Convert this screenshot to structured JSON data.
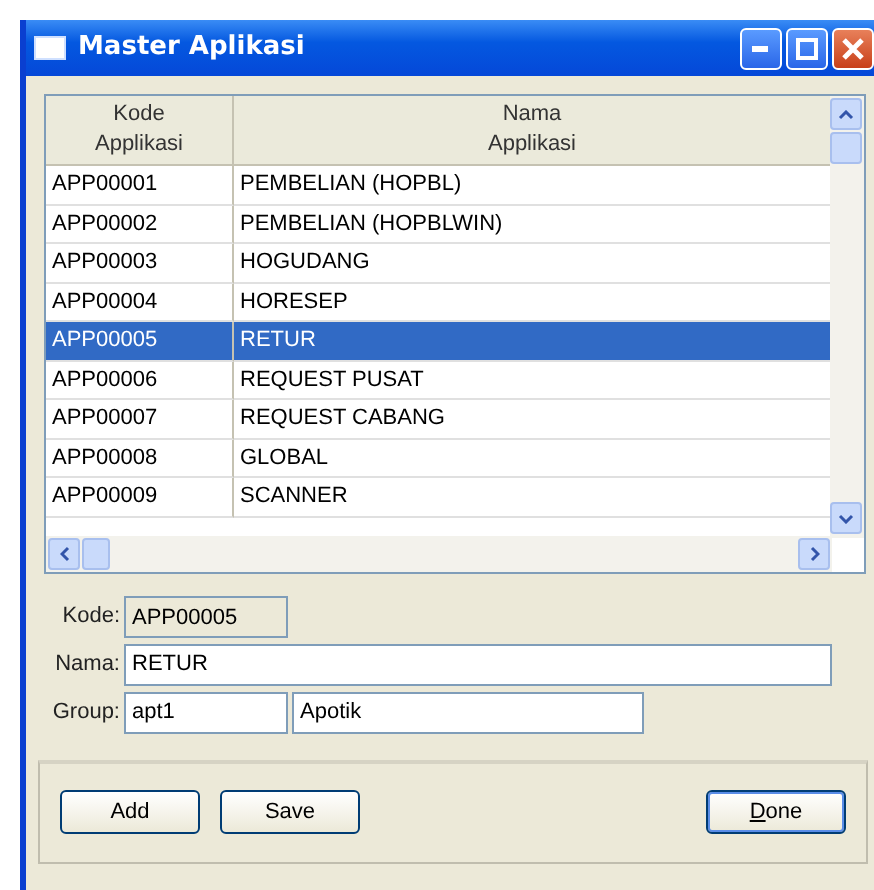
{
  "window": {
    "title": "Master Aplikasi"
  },
  "table": {
    "columns": [
      {
        "line1": "Kode",
        "line2": "Applikasi"
      },
      {
        "line1": "Nama",
        "line2": "Applikasi"
      }
    ],
    "rows": [
      {
        "kode": "APP00001",
        "nama": "PEMBELIAN (HOPBL)",
        "selected": false
      },
      {
        "kode": "APP00002",
        "nama": "PEMBELIAN (HOPBLWIN)",
        "selected": false
      },
      {
        "kode": "APP00003",
        "nama": "HOGUDANG",
        "selected": false
      },
      {
        "kode": "APP00004",
        "nama": "HORESEP",
        "selected": false
      },
      {
        "kode": "APP00005",
        "nama": "RETUR",
        "selected": true
      },
      {
        "kode": "APP00006",
        "nama": "REQUEST PUSAT",
        "selected": false
      },
      {
        "kode": "APP00007",
        "nama": "REQUEST CABANG",
        "selected": false
      },
      {
        "kode": "APP00008",
        "nama": "GLOBAL",
        "selected": false
      },
      {
        "kode": "APP00009",
        "nama": "SCANNER",
        "selected": false
      }
    ]
  },
  "form": {
    "kode": {
      "label": "Kode:",
      "value": "APP00005",
      "disabled": true
    },
    "nama": {
      "label": "Nama:",
      "value": "RETUR"
    },
    "group": {
      "label": "Group:",
      "code": "apt1",
      "name": "Apotik"
    }
  },
  "buttons": [
    {
      "label": "Add",
      "mnemonic": false,
      "default": false
    },
    {
      "label": "Save",
      "mnemonic": false,
      "default": false
    },
    {
      "label": "Done",
      "mnemonic": true,
      "default": true
    }
  ]
}
